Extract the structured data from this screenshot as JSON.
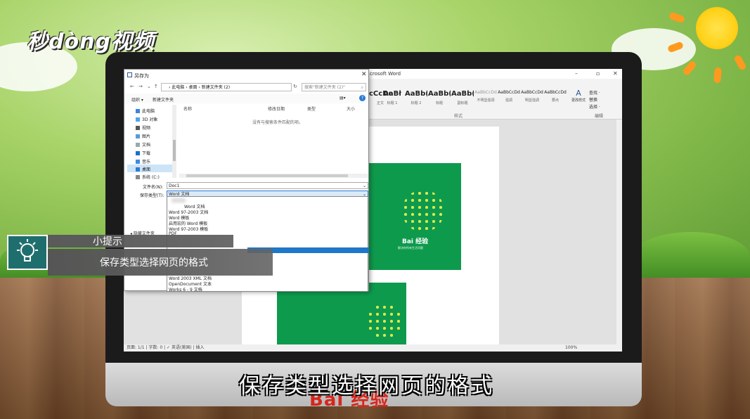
{
  "brand": {
    "logo_text": "秒dòng视频"
  },
  "word": {
    "title": "crosoft Word",
    "styles": [
      {
        "sample": "cCcDd",
        "label": "正文"
      },
      {
        "sample": "AaBł",
        "label": "标题 1"
      },
      {
        "sample": "AaBb(",
        "label": "标题 2"
      },
      {
        "sample": "AaBb(",
        "label": "标题"
      },
      {
        "sample": "AaBb(",
        "label": "副标题"
      },
      {
        "sample": "AaBbCcDd",
        "label": "不明显强调"
      },
      {
        "sample": "AaBbCcDd",
        "label": "强调"
      },
      {
        "sample": "AaBbCcDd",
        "label": "明显强调"
      },
      {
        "sample": "AaBbCcDd",
        "label": "要点"
      }
    ],
    "styles_group_label": "样式",
    "change_styles": "更改样式",
    "edit_tools": [
      "查找 ·",
      "替换",
      "选择 ·"
    ],
    "edit_group_label": "编辑",
    "baidu_mini_text": "Bai 经验",
    "baidu_mini_sub": "解决你所有生活问题",
    "status_text": "页面: 1/1  |  字数: 0  |  ✓  英语(美国)  |  插入",
    "zoom": "100%"
  },
  "dialog": {
    "title": "另存为",
    "breadcrumb": "› 此电脑 › 桌面 › 新建文件夹 (2)",
    "search_placeholder": "搜索\"新建文件夹 (2)\"",
    "organize": "组织 ▾",
    "new_folder": "新建文件夹",
    "tree": [
      "此电脑",
      "3D 对象",
      "视频",
      "图片",
      "文档",
      "下载",
      "音乐",
      "桌面",
      "系统 (C:)"
    ],
    "columns": [
      "名称",
      "修改日期",
      "类型",
      "大小"
    ],
    "empty_message": "没有与搜索条件匹配的项。",
    "filename_label": "文件名(N):",
    "filename_value": "Doc1",
    "filetype_label": "保存类型(T):",
    "filetype_value": "Word 文档",
    "type_options": [
      "Word 文档",
      "Word 97-2003 文档",
      "Word 模板",
      "启用宏的 Word 模板",
      "Word 97-2003 模板",
      "PDF"
    ],
    "type_options_bottom": [
      "Word 2003 XML 文档",
      "OpenDocument 文本",
      "Works 6 - 9 文档"
    ],
    "hidden_folders": "◂ 隐藏文件夹"
  },
  "tip": {
    "title": "小提示",
    "text": "保存类型选择网页的格式"
  },
  "subtitle": "保存类型选择网页的格式",
  "watermark": "Bai 经验",
  "colors": {
    "word_green": "#0e9a4d",
    "selection_blue": "#cce4f7",
    "baidu_red": "#d8261b",
    "tip_teal": "#1f6e6e"
  }
}
